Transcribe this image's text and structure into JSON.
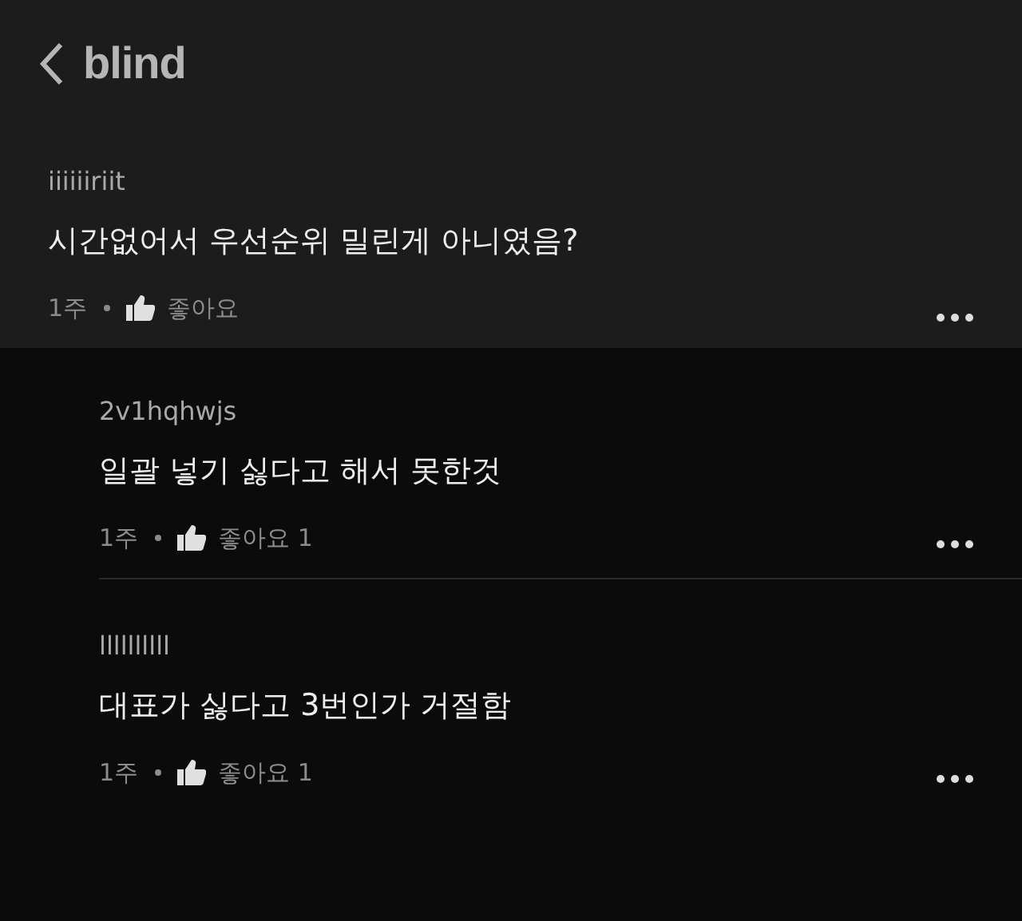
{
  "header": {
    "logo": "blind"
  },
  "comment": {
    "author": "iiiiiiriit",
    "text": "시간없어서 우선순위 밀린게 아니였음?",
    "time": "1주",
    "likes": "좋아요",
    "replies": [
      {
        "author": "2v1hqhwjs",
        "text": "일괄 넣기 싫다고 해서 못한것",
        "time": "1주",
        "likes": "좋아요 1"
      },
      {
        "author": "llllllllll",
        "text": "대표가 싫다고 3번인가 거절함",
        "time": "1주",
        "likes": "좋아요 1"
      }
    ]
  }
}
